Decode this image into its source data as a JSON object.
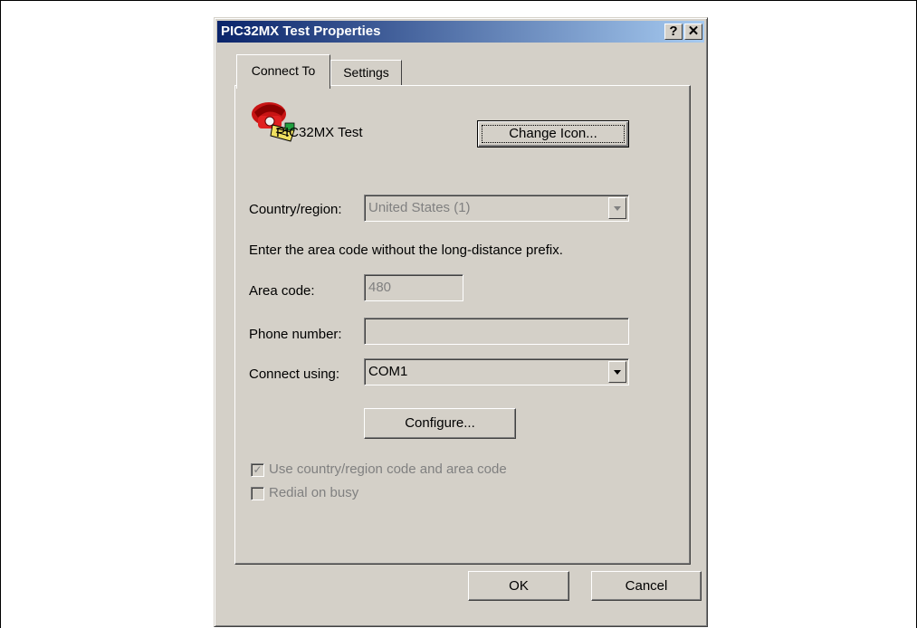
{
  "window": {
    "title": "PIC32MX Test Properties",
    "help_btn": "?",
    "close_btn": "✕"
  },
  "tabs": [
    {
      "label": "Connect To",
      "active": true
    },
    {
      "label": "Settings",
      "active": false
    }
  ],
  "connection": {
    "name": "PIC32MX Test",
    "icon": "telephone-icon",
    "change_icon_label": "Change Icon..."
  },
  "form": {
    "country_label": "Country/region:",
    "country_value": "United States (1)",
    "instruction": "Enter the area code without the long-distance prefix.",
    "area_code_label": "Area code:",
    "area_code_value": "480",
    "phone_label": "Phone number:",
    "phone_value": "",
    "connect_using_label": "Connect using:",
    "connect_using_value": "COM1",
    "configure_label": "Configure..."
  },
  "options": {
    "use_country_label": "Use country/region code and area code",
    "use_country_checked": true,
    "redial_label": "Redial on busy",
    "redial_checked": false
  },
  "footer": {
    "ok_label": "OK",
    "cancel_label": "Cancel"
  }
}
